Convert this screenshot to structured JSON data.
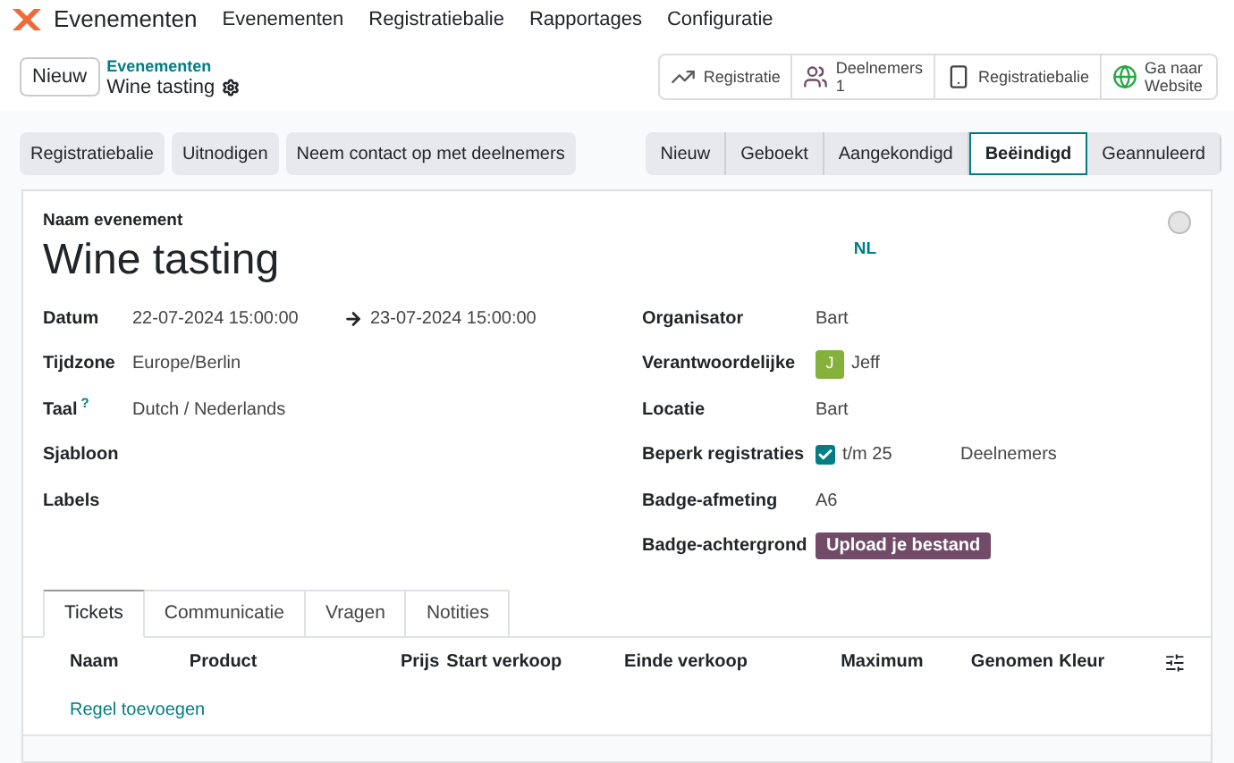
{
  "navbar": {
    "app_name": "Evenementen",
    "menu": [
      "Evenementen",
      "Registratiebalie",
      "Rapportages",
      "Configuratie"
    ]
  },
  "control_panel": {
    "new_button": "Nieuw",
    "breadcrumb": "Evenementen",
    "record_title": "Wine tasting",
    "smart_buttons": [
      {
        "kind": "chart",
        "label": "Registratie"
      },
      {
        "kind": "people",
        "label": "Deelnemers",
        "count": "1"
      },
      {
        "kind": "phone",
        "label": "Registratiebalie"
      },
      {
        "kind": "globe",
        "label": "Ga naar Website"
      }
    ]
  },
  "action_buttons": [
    "Registratiebalie",
    "Uitnodigen",
    "Neem contact op met deelnemers"
  ],
  "stages": [
    {
      "label": "Nieuw",
      "selected": false
    },
    {
      "label": "Geboekt",
      "selected": false
    },
    {
      "label": "Aangekondigd",
      "selected": false
    },
    {
      "label": "Beëindigd",
      "selected": true
    },
    {
      "label": "Geannuleerd",
      "selected": false
    }
  ],
  "form": {
    "name_label": "Naam evenement",
    "name": "Wine tasting",
    "language_badge": "NL",
    "kanban_done": false,
    "left_fields": [
      {
        "label": "Datum",
        "value": "22-07-2024 15:00:00",
        "value_end": "23-07-2024 15:00:00"
      },
      {
        "label": "Tijdzone",
        "value": "Europe/Berlin"
      },
      {
        "label": "Taal",
        "help": "?",
        "value": "Dutch / Nederlands"
      },
      {
        "label": "Sjabloon"
      },
      {
        "label": "Labels"
      }
    ],
    "right_fields": [
      {
        "kind": "text",
        "label": "Organisator",
        "value": "Bart"
      },
      {
        "kind": "user",
        "label": "Verantwoordelijke",
        "avatar": "J",
        "color": "#84b13a",
        "value": "Jeff"
      },
      {
        "kind": "text",
        "label": "Locatie",
        "value": "Bart"
      },
      {
        "kind": "limit",
        "label": "Beperk registraties",
        "checked": true,
        "value": "t/m 25",
        "unit": "Deelnemers"
      },
      {
        "kind": "text",
        "label": "Badge-afmeting",
        "value": "A6"
      },
      {
        "kind": "upload",
        "label": "Badge-achtergrond",
        "value": "Upload je bestand"
      }
    ]
  },
  "notebook": {
    "tabs": [
      {
        "label": "Tickets",
        "selected": true
      },
      {
        "label": "Communicatie",
        "selected": false
      },
      {
        "label": "Vragen",
        "selected": false
      },
      {
        "label": "Notities",
        "selected": false
      }
    ],
    "columns": [
      "Naam",
      "Product",
      "Prijs",
      "Start verkoop",
      "Einde verkoop",
      "Maximum",
      "Genomen",
      "Kleur"
    ],
    "add_line": "Regel toevoegen"
  }
}
